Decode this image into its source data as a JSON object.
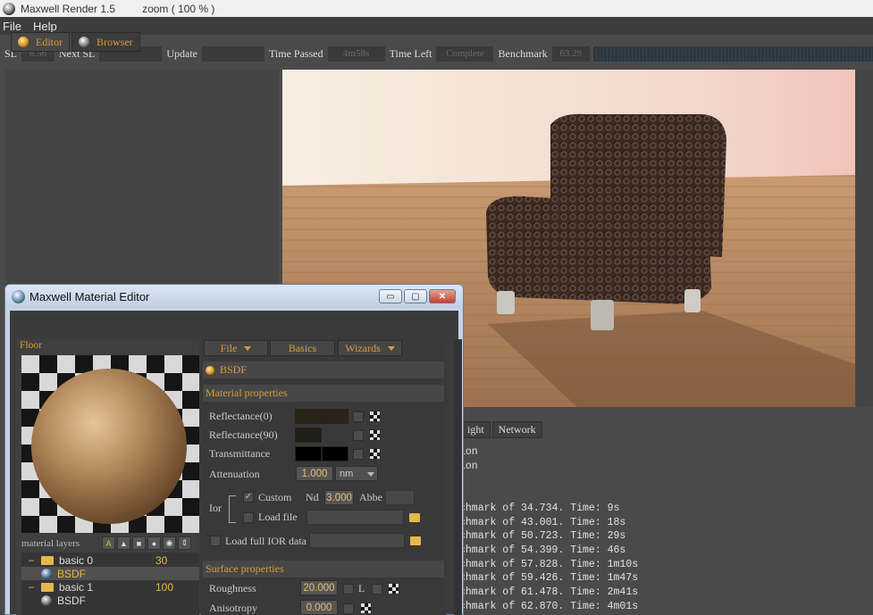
{
  "app": {
    "title": "Maxwell Render 1.5",
    "zoom": "zoom ( 100 % )"
  },
  "menu": [
    {
      "label": "File"
    },
    {
      "label": "Help"
    }
  ],
  "toolbar": {
    "sl_label": "SL",
    "sl_value": "8.56",
    "next_sl_label": "Next SL",
    "next_sl_value": "",
    "update_label": "Update",
    "update_value": "",
    "time_passed_label": "Time Passed",
    "time_passed_value": "4m58s",
    "time_left_label": "Time Left",
    "time_left_value": "Complete",
    "benchmark_label": "Benchmark",
    "benchmark_value": "63.29"
  },
  "console": {
    "tabs": [
      {
        "label": "ight"
      },
      {
        "label": "Network"
      }
    ],
    "lines": [
      "ion",
      "ion",
      "",
      "",
      "chmark of 34.734. Time: 9s",
      "chmark of 43.001. Time: 18s",
      "chmark of 50.723. Time: 29s",
      "chmark of 54.399. Time: 46s",
      "chmark of 57.828. Time: 1m10s",
      "chmark of 59.426. Time: 1m47s",
      "chmark of 61.478. Time: 2m41s",
      "chmark of 62.870. Time: 4m01s"
    ]
  },
  "material_editor": {
    "title": "Maxwell Material Editor",
    "window_buttons": {
      "minimize": "▭",
      "maximize": "▢",
      "close": "✕"
    },
    "tabs": [
      {
        "label": "Editor"
      },
      {
        "label": "Browser"
      }
    ],
    "material_name": "Floor",
    "layers_label": "material layers",
    "layer_tools": [
      "A",
      "▲",
      "■",
      "●",
      "◉",
      "⇕"
    ],
    "layers": [
      {
        "toggle": "−",
        "name": "basic 0",
        "value": "30",
        "bsdf": "BSDF"
      },
      {
        "toggle": "−",
        "name": "basic 1",
        "value": "100",
        "bsdf": "BSDF"
      }
    ],
    "top_buttons": {
      "file": "File",
      "basics": "Basics",
      "wizards": "Wizards"
    },
    "bsdf_label": "BSDF",
    "material_properties": {
      "header": "Material properties",
      "reflectance0": "Reflectance(0)",
      "reflectance90": "Reflectance(90)",
      "transmittance": "Transmittance",
      "attenuation_label": "Attenuation",
      "attenuation_value": "1.000",
      "attenuation_unit": "nm",
      "ior_label": "Ior",
      "custom_label": "Custom",
      "nd_label": "Nd",
      "nd_value": "3.000",
      "abbe_label": "Abbe",
      "abbe_value": "",
      "load_file_label": "Load file",
      "load_full_ior_label": "Load full IOR data"
    },
    "surface_properties": {
      "header": "Surface properties",
      "roughness_label": "Roughness",
      "roughness_value": "20.000",
      "roughness_l": "L",
      "anisotropy_label": "Anisotropy",
      "anisotropy_value": "0.000"
    }
  },
  "colors": {
    "accent_orange": "#d79c3c",
    "reflectance0_color": "#2a2418",
    "reflectance90_color": "#221e18",
    "transmittance_color": "#000000"
  }
}
